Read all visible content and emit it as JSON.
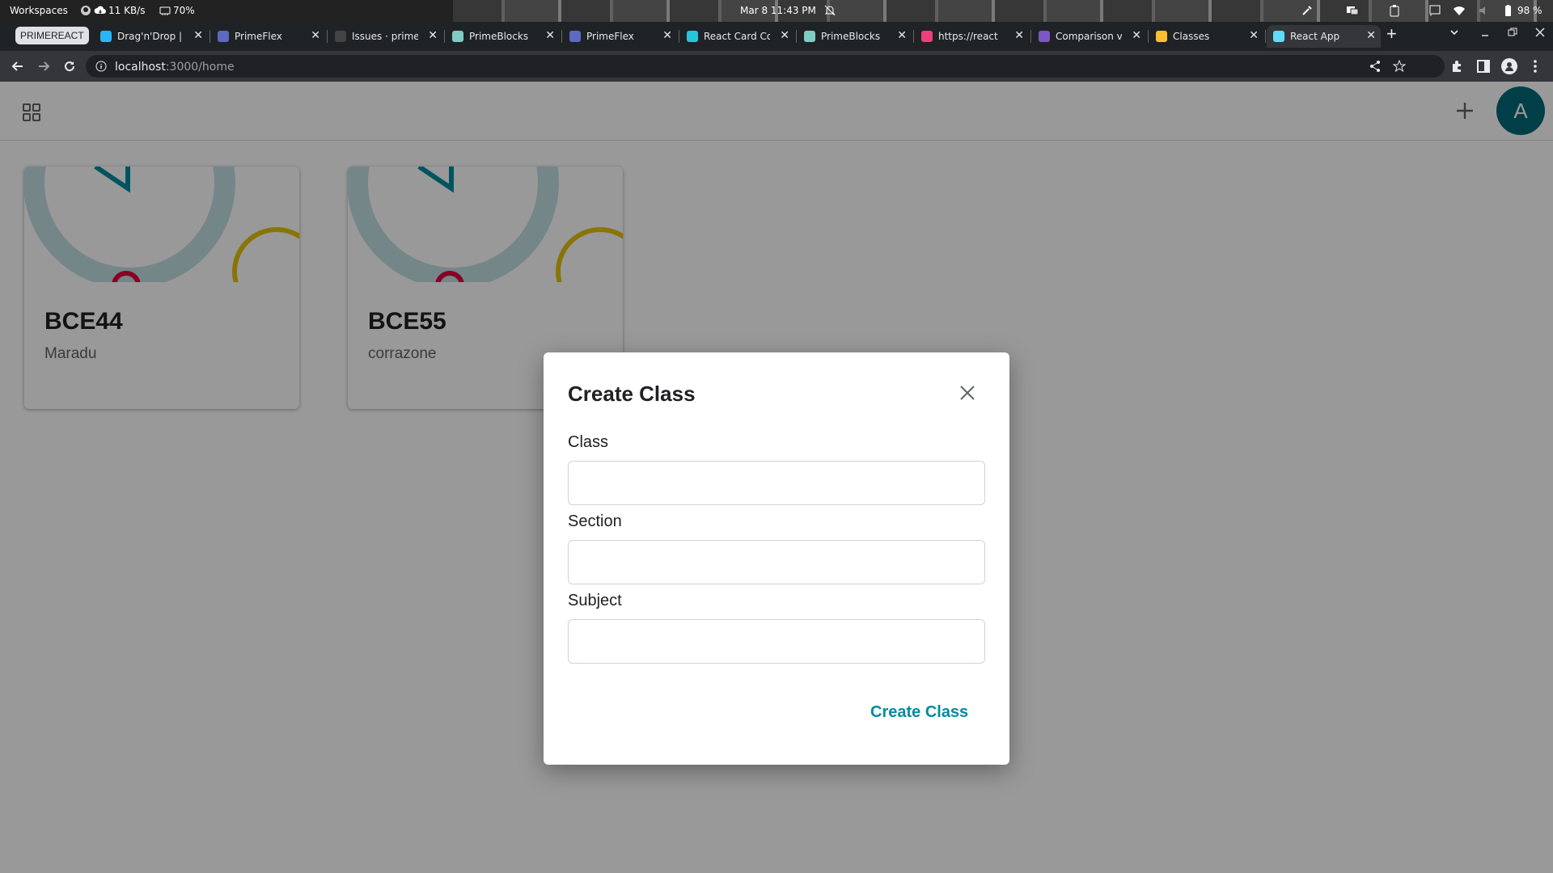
{
  "os_bar": {
    "workspaces": "Workspaces",
    "net_speed": "11 KB/s",
    "memory": "70%",
    "datetime": "Mar 8  11:43 PM",
    "battery": "98 %"
  },
  "browser": {
    "tab_group_label": "PRIMEREACT",
    "tabs": [
      {
        "title": "Drag'n'Drop |",
        "favicon_color": "#29b6f6",
        "icon": "primereact-icon"
      },
      {
        "title": "PrimeFlex",
        "favicon_color": "#5c6bc0",
        "icon": "primeflex-icon"
      },
      {
        "title": "Issues · prime",
        "favicon_color": "#444444",
        "icon": "github-icon"
      },
      {
        "title": "PrimeBlocks",
        "favicon_color": "#80cbc4",
        "icon": "react-icon"
      },
      {
        "title": "PrimeFlex",
        "favicon_color": "#5c6bc0",
        "icon": "primeflex-icon"
      },
      {
        "title": "React Card Co",
        "favicon_color": "#26c6da",
        "icon": "react-card-icon"
      },
      {
        "title": "PrimeBlocks",
        "favicon_color": "#80cbc4",
        "icon": "react-icon"
      },
      {
        "title": "https://react",
        "favicon_color": "#ec407a",
        "icon": "link-icon"
      },
      {
        "title": "Comparison v",
        "favicon_color": "#7e57c2",
        "icon": "comparison-icon"
      },
      {
        "title": "Classes",
        "favicon_color": "#fbc02d",
        "icon": "classroom-icon"
      },
      {
        "title": "React App",
        "favicon_color": "#61dafb",
        "icon": "react-icon",
        "active": true
      }
    ],
    "url_host": "localhost",
    "url_path": ":3000/home"
  },
  "app": {
    "avatar_initial": "A",
    "avatar_color": "#006a78",
    "cards": [
      {
        "title": "BCE44",
        "subtitle": "Maradu"
      },
      {
        "title": "BCE55",
        "subtitle": "corrazone"
      }
    ]
  },
  "dialog": {
    "title": "Create Class",
    "fields": [
      {
        "label": "Class",
        "value": "",
        "placeholder": ""
      },
      {
        "label": "Section",
        "value": "",
        "placeholder": ""
      },
      {
        "label": "Subject",
        "value": "",
        "placeholder": ""
      }
    ],
    "submit_label": "Create Class",
    "accent_color": "#008c9e"
  }
}
